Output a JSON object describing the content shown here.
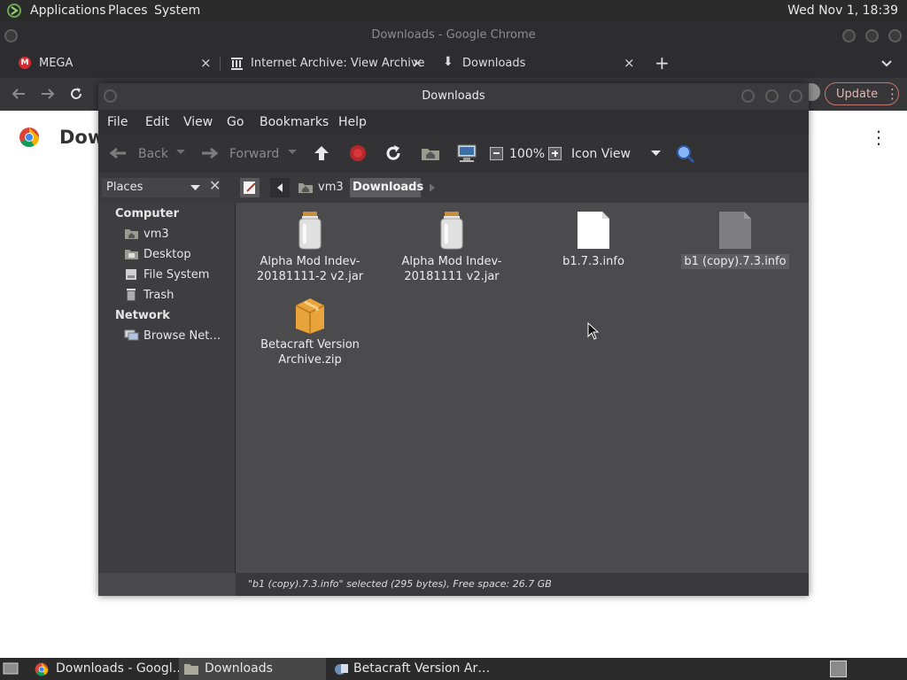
{
  "top_panel": {
    "applications": "Applications",
    "places": "Places",
    "system": "System",
    "clock": "Wed Nov 1, 18:39"
  },
  "chrome": {
    "window_title": "Downloads - Google Chrome",
    "tabs": [
      {
        "label": "MEGA",
        "close": "×"
      },
      {
        "label": "Internet Archive: View Archive",
        "close": "×"
      },
      {
        "label": "Downloads",
        "close": "×"
      }
    ],
    "new_tab": "+",
    "update_label": "Update",
    "page_title": "Dow",
    "more_menu": "⋮"
  },
  "nautilus": {
    "title": "Downloads",
    "menu": [
      "File",
      "Edit",
      "View",
      "Go",
      "Bookmarks",
      "Help"
    ],
    "toolbar": {
      "back": "Back",
      "forward": "Forward",
      "zoom": "100%",
      "view_mode": "Icon View"
    },
    "sidebar_select": "Places",
    "breadcrumb": [
      "vm3",
      "Downloads"
    ],
    "sidebar": {
      "computer_header": "Computer",
      "computer_items": [
        "vm3",
        "Desktop",
        "File System",
        "Trash"
      ],
      "network_header": "Network",
      "network_items": [
        "Browse Net…"
      ]
    },
    "files": [
      {
        "line1": "Alpha Mod Indev-",
        "line2": "20181111-2 v2.jar",
        "type": "jar"
      },
      {
        "line1": "Alpha Mod Indev-",
        "line2": "20181111 v2.jar",
        "type": "jar"
      },
      {
        "line1": "b1.7.3.info",
        "line2": "",
        "type": "text"
      },
      {
        "line1": "b1 (copy).7.3.info",
        "line2": "",
        "type": "text",
        "selected": true
      },
      {
        "line1": "Betacraft Version",
        "line2": "Archive.zip",
        "type": "zip"
      }
    ],
    "status": "\"b1 (copy).7.3.info\" selected (295 bytes), Free space: 26.7 GB"
  },
  "taskbar": {
    "items": [
      "Downloads - Googl…",
      "Downloads",
      "Betacraft Version Ar…"
    ]
  }
}
